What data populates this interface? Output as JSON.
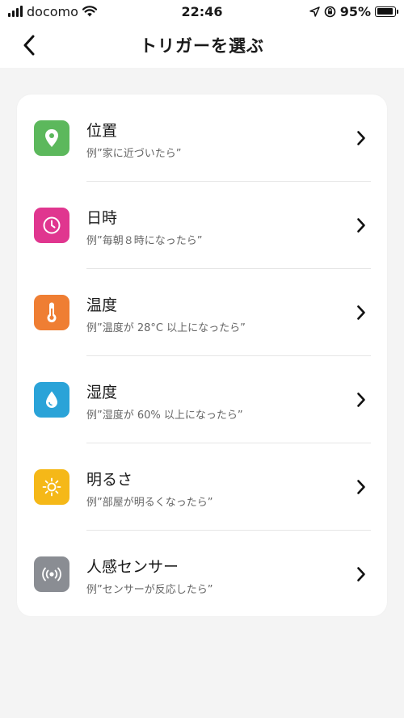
{
  "status": {
    "carrier": "docomo",
    "time": "22:46",
    "battery": "95%",
    "battery_level": 0.95
  },
  "header": {
    "title": "トリガーを選ぶ"
  },
  "colors": {
    "location": "#5cb85c",
    "datetime": "#e0368f",
    "temperature": "#ef7e33",
    "humidity": "#2aa3d8",
    "brightness": "#f5b818",
    "sensor": "#8a8d93"
  },
  "triggers": [
    {
      "icon": "location-pin-icon",
      "title": "位置",
      "example": "例”家に近づいたら”"
    },
    {
      "icon": "clock-icon",
      "title": "日時",
      "example": "例”毎朝８時になったら”"
    },
    {
      "icon": "thermometer-icon",
      "title": "温度",
      "example": "例”温度が 28°C 以上になったら”"
    },
    {
      "icon": "water-drop-icon",
      "title": "湿度",
      "example": "例”湿度が 60% 以上になったら”"
    },
    {
      "icon": "sun-icon",
      "title": "明るさ",
      "example": "例”部屋が明るくなったら”"
    },
    {
      "icon": "motion-sensor-icon",
      "title": "人感センサー",
      "example": "例”センサーが反応したら”"
    }
  ]
}
